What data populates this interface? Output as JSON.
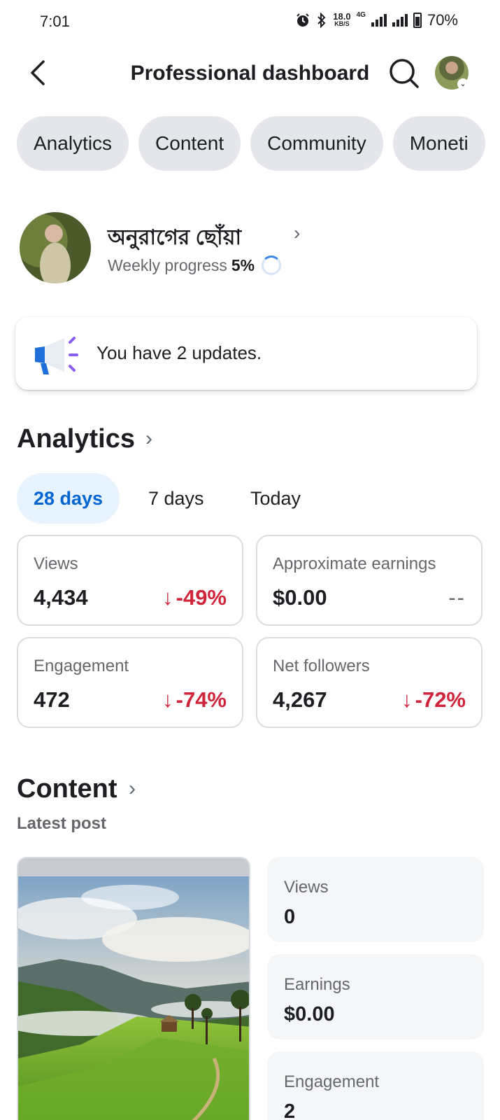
{
  "status_bar": {
    "time": "7:01",
    "net_speed_value": "18.0",
    "net_speed_unit": "KB/S",
    "network_type": "4G",
    "battery": "70%"
  },
  "header": {
    "title": "Professional dashboard"
  },
  "tabs": [
    "Analytics",
    "Content",
    "Community",
    "Moneti"
  ],
  "profile": {
    "name": "অনুরাগের ছোঁয়া",
    "weekly_label": "Weekly progress",
    "weekly_value": "5%",
    "weekly_fraction": 0.05
  },
  "updates": {
    "text": "You have 2 updates."
  },
  "analytics": {
    "title": "Analytics",
    "ranges": [
      "28 days",
      "7 days",
      "Today"
    ],
    "active_range": "28 days",
    "metrics": [
      {
        "label": "Views",
        "value": "4,434",
        "change": "-49%",
        "arrow": "↓"
      },
      {
        "label": "Approximate earnings",
        "value": "$0.00",
        "change": "--",
        "arrow": ""
      },
      {
        "label": "Engagement",
        "value": "472",
        "change": "-74%",
        "arrow": "↓"
      },
      {
        "label": "Net followers",
        "value": "4,267",
        "change": "-72%",
        "arrow": "↓"
      }
    ]
  },
  "content": {
    "title": "Content",
    "latest_label": "Latest post",
    "stats": [
      {
        "label": "Views",
        "value": "0"
      },
      {
        "label": "Earnings",
        "value": "$0.00"
      },
      {
        "label": "Engagement",
        "value": "2"
      }
    ]
  },
  "colors": {
    "accent": "#0064d1",
    "negative": "#d0243b",
    "chip_bg": "#e4e6eb"
  }
}
